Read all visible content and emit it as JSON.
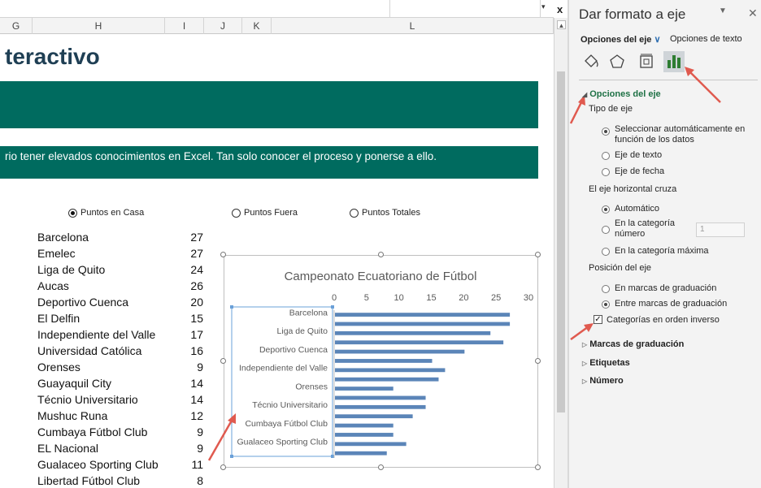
{
  "sheet": {
    "columns": [
      "G",
      "H",
      "I",
      "J",
      "K",
      "L"
    ],
    "title": "teractivo",
    "description": "rio tener elevados conocimientos en Excel. Tan solo conocer el proceso y ponerse a ello.",
    "radios": [
      {
        "label": "Puntos en Casa",
        "selected": true
      },
      {
        "label": "Puntos Fuera",
        "selected": false
      },
      {
        "label": "Puntos Totales",
        "selected": false
      }
    ],
    "teams": [
      {
        "name": "Barcelona",
        "points": "27"
      },
      {
        "name": "Emelec",
        "points": "27"
      },
      {
        "name": "Liga de Quito",
        "points": "24"
      },
      {
        "name": "Aucas",
        "points": "26"
      },
      {
        "name": "Deportivo Cuenca",
        "points": "20"
      },
      {
        "name": "El Delfin",
        "points": "15"
      },
      {
        "name": "Independiente del Valle",
        "points": "17"
      },
      {
        "name": "Universidad Católica",
        "points": "16"
      },
      {
        "name": "Orenses",
        "points": "9"
      },
      {
        "name": "Guayaquil City",
        "points": "14"
      },
      {
        "name": "Técnio Universitario",
        "points": "14"
      },
      {
        "name": "Mushuc Runa",
        "points": "12"
      },
      {
        "name": "Cumbaya Fútbol Club",
        "points": "9"
      },
      {
        "name": "EL Nacional",
        "points": "9"
      },
      {
        "name": "Gualaceo Sporting Club",
        "points": "11"
      },
      {
        "name": "Libertad Fútbol Club",
        "points": "8"
      }
    ],
    "colors": {
      "banner": "#006b5f",
      "title": "#1f3f54",
      "bar": "#5b85b8",
      "arrow": "#e05a4f"
    }
  },
  "chart_data": {
    "type": "bar",
    "orientation": "horizontal",
    "title": "Campeonato Ecuatoriano de Fútbol",
    "categories": [
      "Barcelona",
      "Emelec",
      "Liga de Quito",
      "Aucas",
      "Deportivo Cuenca",
      "El Delfin",
      "Independiente del Valle",
      "Universidad Católica",
      "Orenses",
      "Guayaquil City",
      "Técnio Universitario",
      "Mushuc Runa",
      "Cumbaya Fútbol Club",
      "EL Nacional",
      "Gualaceo Sporting Club",
      "Libertad Fútbol Club"
    ],
    "visible_tick_labels": [
      "Barcelona",
      "Liga de Quito",
      "Deportivo Cuenca",
      "Independiente del Valle",
      "Orenses",
      "Técnio Universitario",
      "Cumbaya Fútbol Club",
      "Gualaceo Sporting Club"
    ],
    "values": [
      27,
      27,
      24,
      26,
      20,
      15,
      17,
      16,
      9,
      14,
      14,
      12,
      9,
      9,
      11,
      8
    ],
    "xticks": [
      "0",
      "5",
      "10",
      "15",
      "20",
      "25",
      "30"
    ],
    "xlim": [
      0,
      30
    ],
    "axis_position": "top",
    "legend": "none"
  },
  "pane": {
    "title": "Dar formato a eje",
    "tab_axis": "Opciones del eje",
    "tab_text": "Opciones de texto",
    "icons": [
      "fill-line-icon",
      "effects-icon",
      "size-properties-icon",
      "axis-options-icon"
    ],
    "section_axis_options": "Opciones del eje",
    "axis_type_label": "Tipo de eje",
    "auto_select_line1": "Seleccionar automáticamente en",
    "auto_select_line2": "función de los datos",
    "text_axis": "Eje de texto",
    "date_axis": "Eje de fecha",
    "crosses_label": "El eje horizontal cruza",
    "automatic": "Automático",
    "at_category_line1": "En la categoría",
    "at_category_line2": "número",
    "category_number_value": "1",
    "max_category": "En la categoría máxima",
    "position_label": "Posición del eje",
    "on_tick_marks": "En marcas de graduación",
    "between_tick_marks": "Entre marcas de graduación",
    "reverse_order": "Categorías en orden inverso",
    "tick_marks": "Marcas de graduación",
    "labels": "Etiquetas",
    "number": "Número",
    "axis_type_selected": "auto",
    "crosses_selected": "automatic",
    "position_selected": "between",
    "reverse_checked": true
  }
}
